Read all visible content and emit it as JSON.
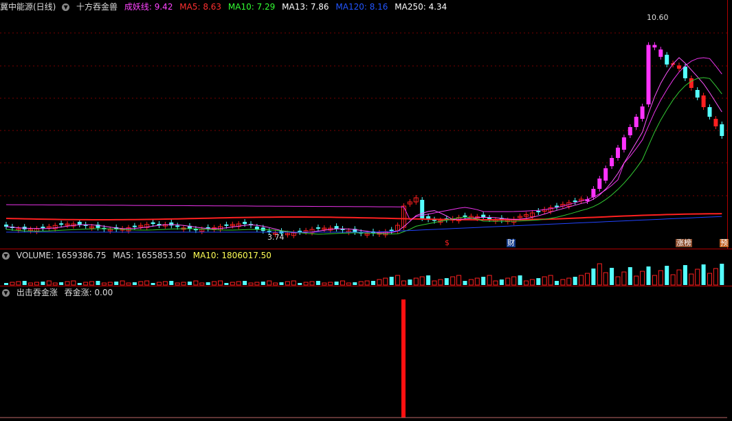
{
  "main": {
    "title": "冀中能源(日线)",
    "indicator_name": "十方吞金兽",
    "legend": [
      {
        "label": "成妖线: 9.42",
        "color": "#ff44ff"
      },
      {
        "label": "MA5: 8.63",
        "color": "#ff3030"
      },
      {
        "label": "MA10: 7.29",
        "color": "#33ff33"
      },
      {
        "label": "MA13: 7.86",
        "color": "#ffffff"
      },
      {
        "label": "MA120: 8.16",
        "color": "#2255ff"
      },
      {
        "label": "MA250: 4.34",
        "color": "#ffffff"
      }
    ],
    "high_label": "10.60",
    "low_label": "3.74",
    "markers": [
      {
        "text": "$",
        "color": "#ff2222",
        "bg": "transparent"
      },
      {
        "text": "财",
        "color": "#ffffff",
        "bg": "#123a8a"
      },
      {
        "text": "涨榜",
        "color": "#ffffff",
        "bg": "#8a4a2a"
      },
      {
        "text": "预",
        "color": "#ffffff",
        "bg": "#c06020"
      }
    ]
  },
  "volume": {
    "legend": [
      {
        "label": "VOLUME: 1659386.75",
        "color": "#dddddd"
      },
      {
        "label": "MA5: 1655853.50",
        "color": "#dddddd"
      },
      {
        "label": "MA10: 1806017.50",
        "color": "#ffff55"
      }
    ]
  },
  "signal": {
    "legend": [
      {
        "label": "出击吞金涨",
        "color": "#dddddd"
      },
      {
        "label": "吞金涨: 0.00",
        "color": "#dddddd"
      }
    ]
  },
  "colors": {
    "up": "#ff2020",
    "down": "#55ffff",
    "pink": "#ff33ff",
    "grid": "#8a0000"
  }
}
